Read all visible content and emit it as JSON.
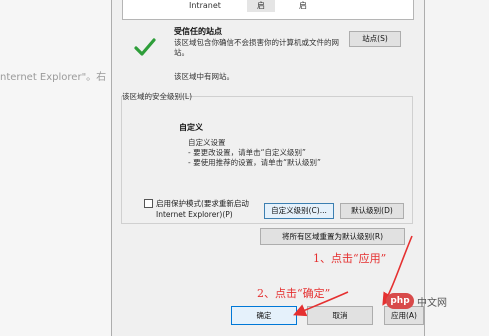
{
  "background": {
    "snippet": "nternet Explorer\"。右"
  },
  "zone_list": {
    "name": "Intranet",
    "col1": "启",
    "col2": "启"
  },
  "trusted_sites": {
    "title": "受信任的站点",
    "description": "该区域包含你确信不会损害你的计算机或文件的网站。",
    "none_text": "该区域中有网站。",
    "sites_button": "站点(S)"
  },
  "security": {
    "group_label": "该区域的安全级别(L)",
    "custom_title": "自定义",
    "custom_line1": "自定义设置",
    "custom_line2": "- 要更改设置，请单击“自定义级别”",
    "custom_line3": "- 要使用推荐的设置，请单击“默认级别”",
    "protected_mode_label": "启用保护模式(要求重新启动 Internet Explorer)(P)",
    "protected_mode_checked": false,
    "custom_level_button": "自定义级别(C)...",
    "default_level_button": "默认级别(D)",
    "reset_all_button": "将所有区域重置为默认级别(R)"
  },
  "footer": {
    "ok_button": "确定",
    "cancel_button": "取消",
    "apply_button": "应用(A)"
  },
  "annotations": {
    "step1": "1、点击“应用”",
    "step2": "2、点击“确定”",
    "color": "#e53030"
  },
  "watermark": {
    "logo": "php",
    "text": "中文网"
  },
  "icons": {
    "trusted": "checkmark-icon"
  }
}
